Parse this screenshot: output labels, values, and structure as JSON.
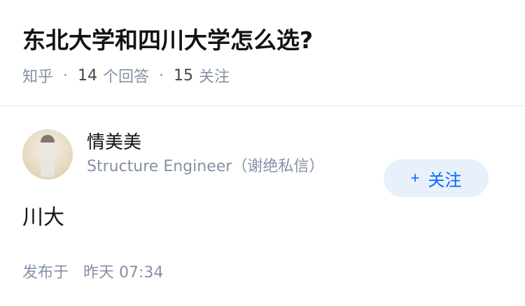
{
  "question": {
    "title": "东北大学和四川大学怎么选?",
    "source": "知乎",
    "answers_count": "14",
    "answers_label": "个回答",
    "followers_count": "15",
    "followers_label": "关注"
  },
  "answer": {
    "author": {
      "name": "情美美",
      "bio": "Structure Engineer（谢绝私信）",
      "avatar_icon": "avatar-image"
    },
    "follow_button": {
      "icon": "plus-icon",
      "label": "关注"
    },
    "content": "川大",
    "published_label": "发布于",
    "published_time": "昨天 07:34"
  },
  "colors": {
    "accent": "#0066ff",
    "follow_bg": "#e8f1fb",
    "meta_text": "#8590a6"
  }
}
